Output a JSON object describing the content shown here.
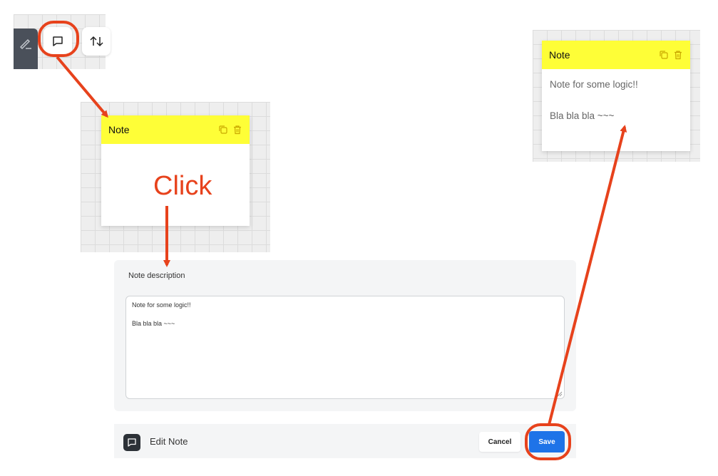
{
  "toolbar": {
    "icons": [
      "pen-icon",
      "chat-bubble-icon",
      "sort-arrows-icon"
    ],
    "highlighted": "chat-bubble-icon"
  },
  "note_default": {
    "title": "Note",
    "body_lines": []
  },
  "note_result": {
    "title": "Note",
    "body_lines": [
      "Note for some logic!!",
      "Bla bla bla ~~~"
    ]
  },
  "annotation": {
    "click_text": "Click",
    "color": "#e7421c"
  },
  "edit_panel": {
    "label": "Note description",
    "value_lines": [
      "Note for some logic!!",
      "Bla bla bla ~~~"
    ]
  },
  "footer": {
    "title": "Edit Note",
    "cancel_label": "Cancel",
    "save_label": "Save"
  },
  "colors": {
    "note_header": "#fefe37",
    "accent": "#1e73e8",
    "annotation": "#e7421c"
  }
}
